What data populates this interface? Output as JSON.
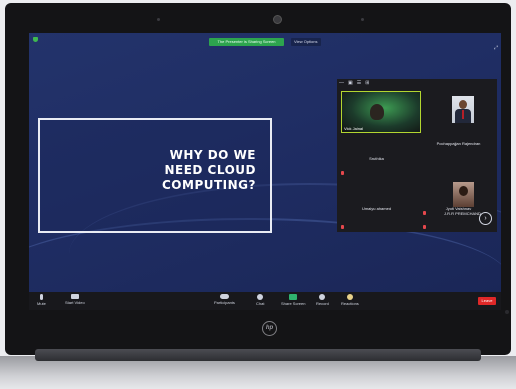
{
  "meeting": {
    "recording_banner": "The Presenter is Sharing Screen",
    "view_label": "View Options",
    "slide_title_lines": [
      "WHY DO WE",
      "NEED CLOUD",
      "COMPUTING?"
    ]
  },
  "gallery": {
    "toolbar": [
      "—",
      "▣",
      "☰",
      "⊞"
    ],
    "participants": [
      {
        "name": "Vick Jainal",
        "video": true
      },
      {
        "name": "Pochappajjan Rajendran",
        "photo": true
      },
      {
        "name": "Sruthika"
      },
      {
        "name": "J.R.R PREMCHAND",
        "photo": true
      },
      {
        "name": "Umaiyu ahamed"
      },
      {
        "name": "Jyoti Vaishnav"
      }
    ],
    "more_label": "›"
  },
  "toolbar": {
    "items": [
      {
        "label": "Mute",
        "icon": "microphone-icon"
      },
      {
        "label": "Start Video",
        "icon": "video-camera-icon"
      },
      {
        "label": "Participants",
        "icon": "participants-icon",
        "badge": "28"
      },
      {
        "label": "Chat",
        "icon": "chat-icon"
      },
      {
        "label": "Share Screen",
        "icon": "share-screen-icon"
      },
      {
        "label": "Record",
        "icon": "record-icon"
      },
      {
        "label": "Reactions",
        "icon": "reactions-icon"
      }
    ],
    "leave_label": "Leave"
  },
  "laptop": {
    "brand": "hp"
  }
}
